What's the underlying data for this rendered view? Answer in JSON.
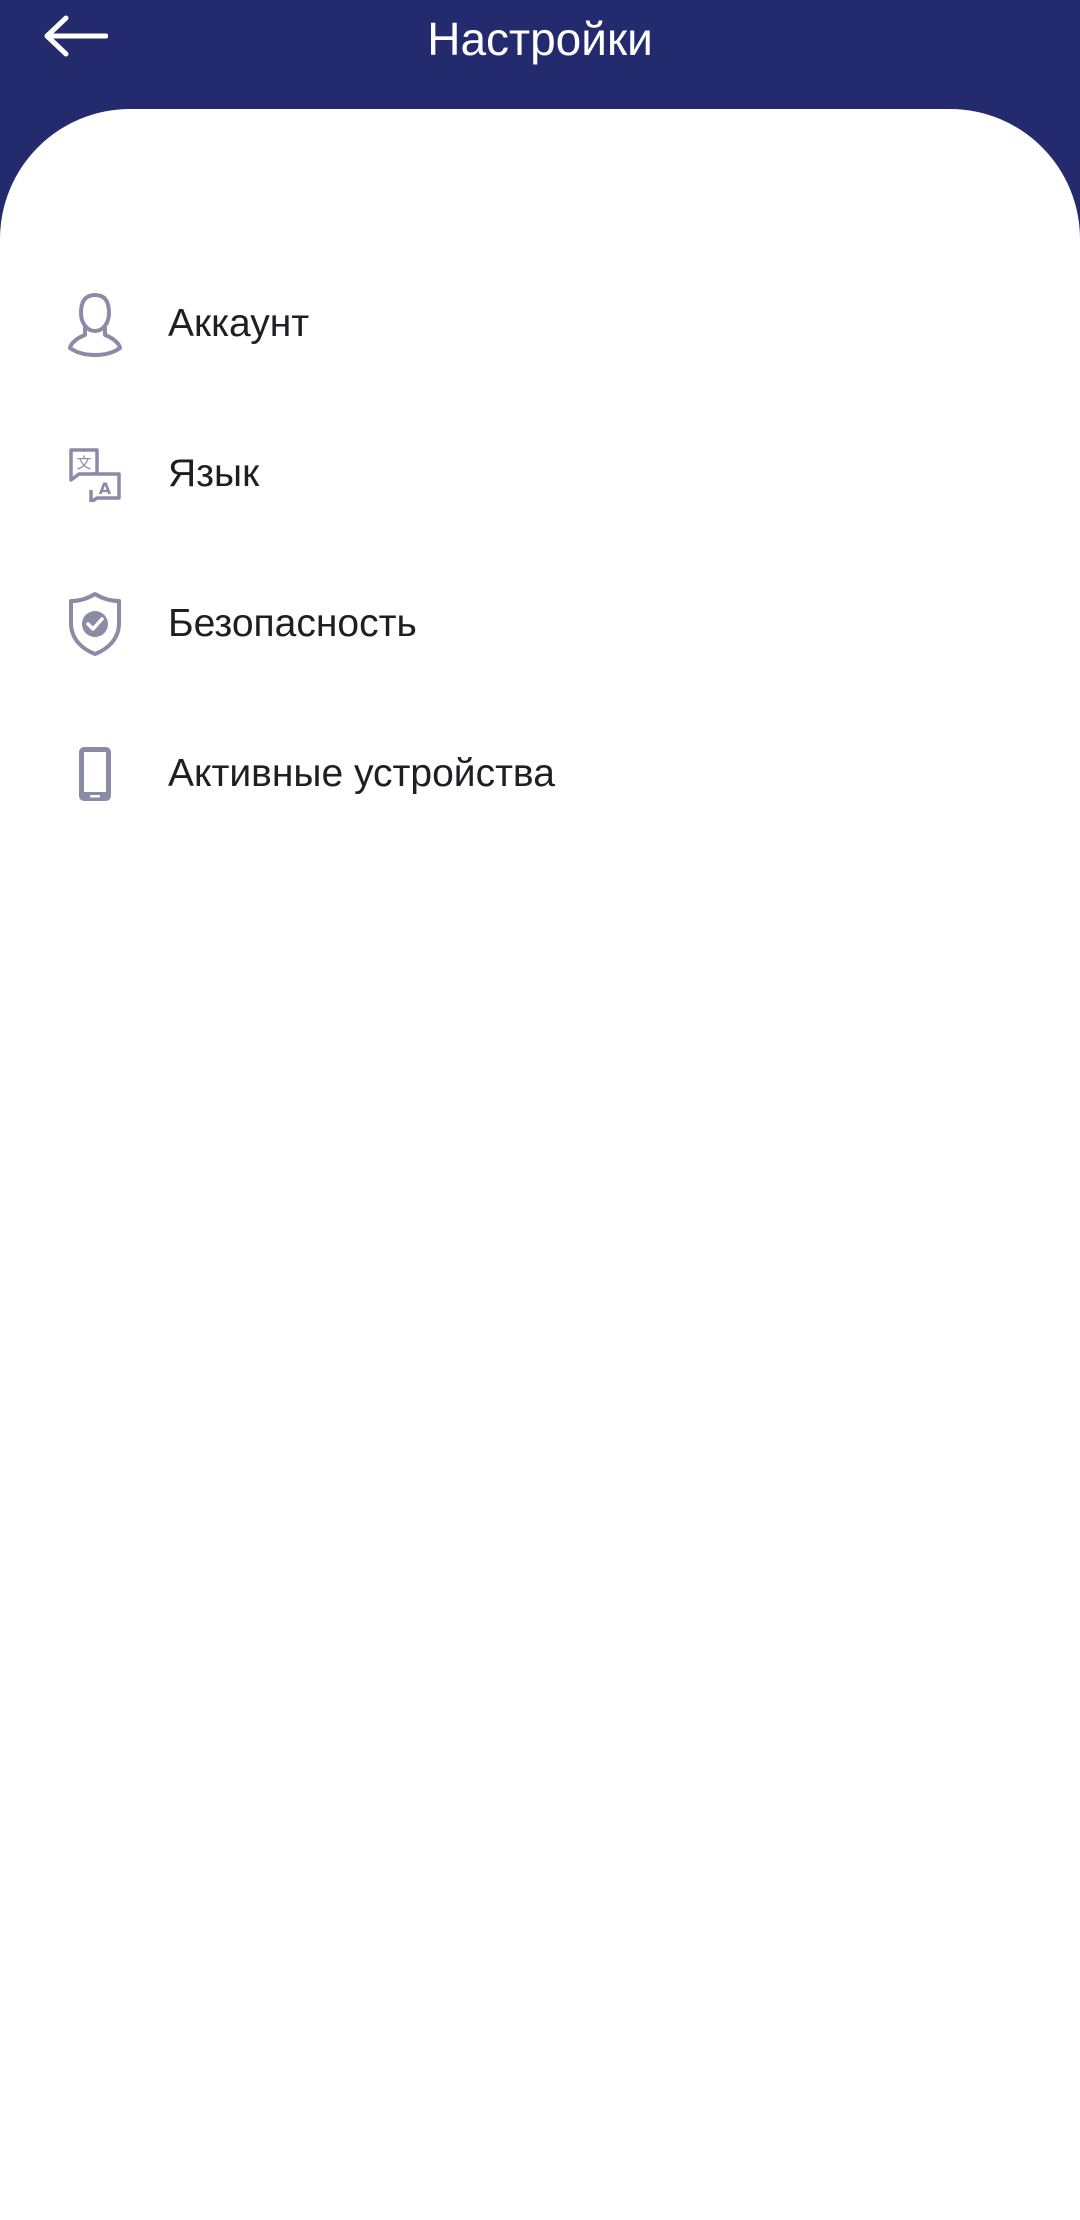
{
  "header": {
    "title": "Настройки",
    "back_icon": "arrow-left-icon"
  },
  "menu": {
    "items": [
      {
        "label": "Аккаунт",
        "icon": "account-icon"
      },
      {
        "label": "Язык",
        "icon": "language-icon"
      },
      {
        "label": "Безопасность",
        "icon": "shield-icon"
      },
      {
        "label": "Активные устройства",
        "icon": "phone-icon"
      }
    ]
  },
  "colors": {
    "header_bg": "#232b6e",
    "icon": "#8a8ca6",
    "text": "#1e1e24",
    "background": "#ffffff"
  }
}
